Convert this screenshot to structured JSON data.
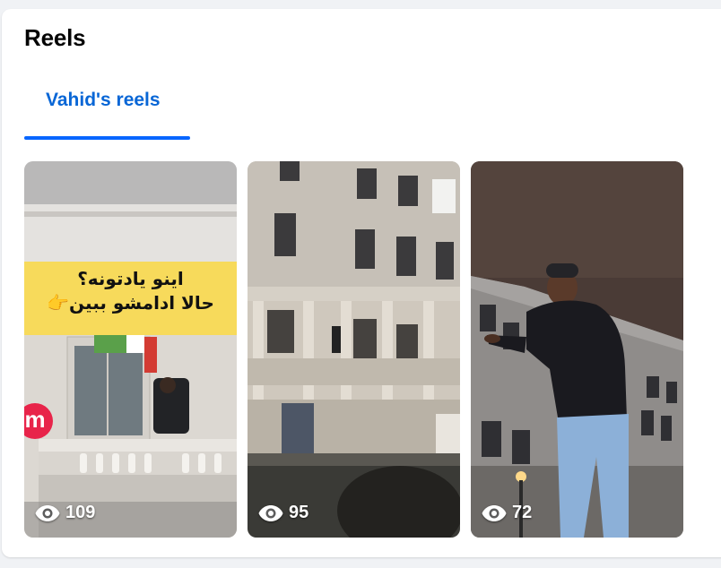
{
  "section": {
    "title": "Reels"
  },
  "tabs": [
    {
      "label": "Vahid's reels",
      "active": true
    }
  ],
  "reels": [
    {
      "views": "109",
      "caption_line1": "اینو یادتونه؟",
      "caption_line2": "حالا ادامشو ببین👉",
      "badge": "m"
    },
    {
      "views": "95"
    },
    {
      "views": "72"
    }
  ],
  "icons": {
    "views": "eye-icon",
    "badge": "m-logo-badge"
  },
  "colors": {
    "accent": "#0866ff",
    "tab_text": "#0866d6",
    "caption_bg": "#f7da5b",
    "badge": "#e8244a"
  }
}
